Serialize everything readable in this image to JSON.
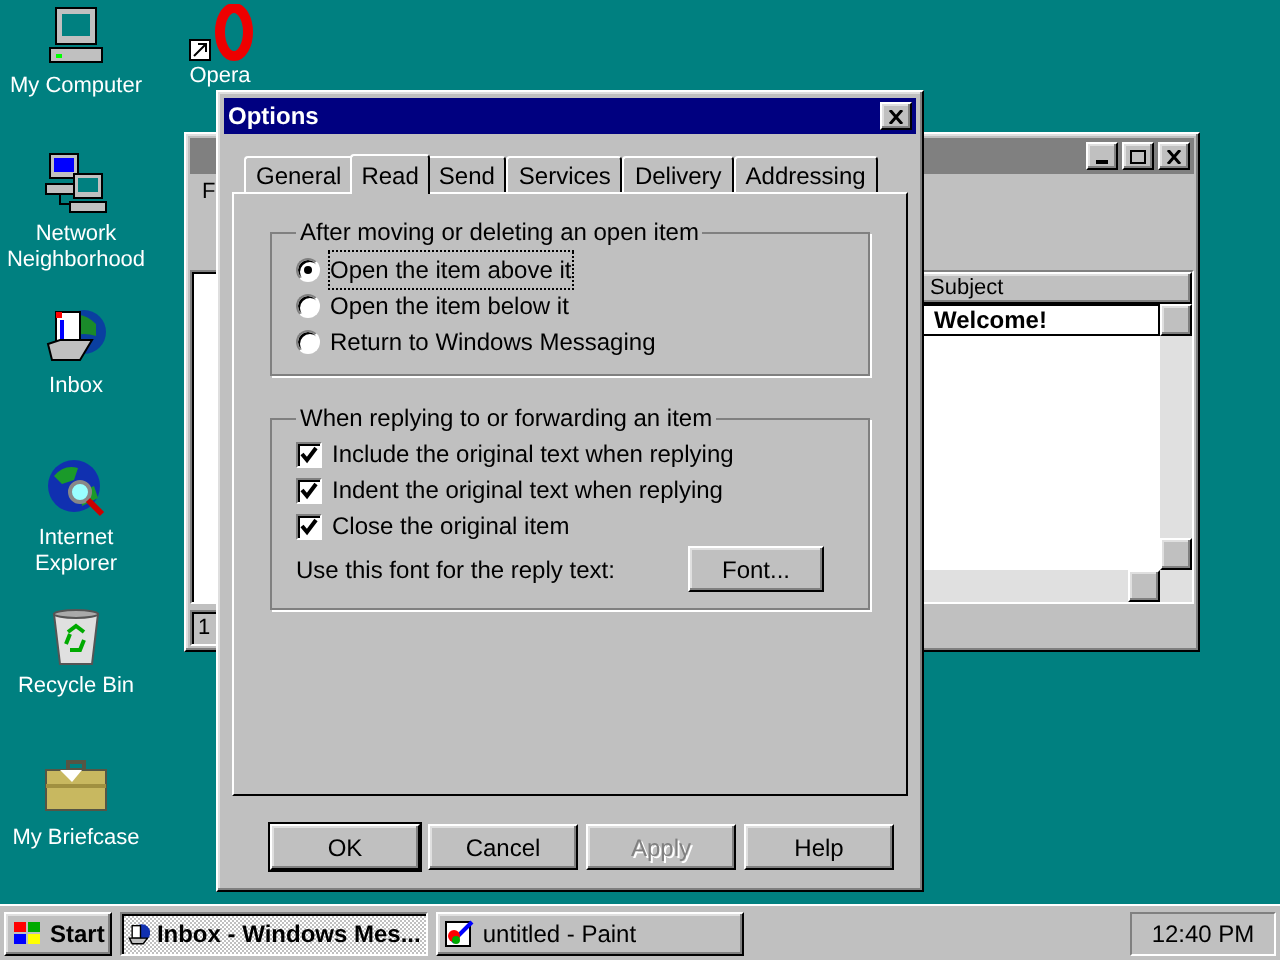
{
  "desktop_icons": [
    {
      "label": "My Computer",
      "kind": "computer"
    },
    {
      "label": "Network Neighborhood",
      "kind": "network"
    },
    {
      "label": "Inbox",
      "kind": "inbox"
    },
    {
      "label": "Internet Explorer",
      "kind": "browser"
    },
    {
      "label": "Recycle Bin",
      "kind": "recycle"
    },
    {
      "label": "My Briefcase",
      "kind": "briefcase"
    }
  ],
  "shortcut_icon": {
    "label": "Opera"
  },
  "background_window": {
    "menu_letter": "F",
    "column": "Subject",
    "row": "Welcome!",
    "status": "1"
  },
  "dialog": {
    "title": "Options",
    "tabs": [
      {
        "label": "General",
        "selected": false
      },
      {
        "label": "Read",
        "selected": true
      },
      {
        "label": "Send",
        "selected": false
      },
      {
        "label": "Services",
        "selected": false
      },
      {
        "label": "Delivery",
        "selected": false
      },
      {
        "label": "Addressing",
        "selected": false
      }
    ],
    "move_group": {
      "title": "After moving or deleting an open item",
      "options": [
        {
          "label": "Open the item above it",
          "selected": true
        },
        {
          "label": "Open the item below it",
          "selected": false
        },
        {
          "label": "Return to Windows Messaging",
          "selected": false
        }
      ]
    },
    "reply_group": {
      "title": "When replying to or forwarding an item",
      "checkboxes": [
        {
          "label": "Include the original text when replying",
          "checked": true
        },
        {
          "label": "Indent the original text when replying",
          "checked": true
        },
        {
          "label": "Close the original item",
          "checked": true
        }
      ],
      "font_label": "Use this font for the reply text:",
      "font_button": "Font..."
    },
    "buttons": [
      {
        "label": "OK",
        "default": true,
        "disabled": false
      },
      {
        "label": "Cancel",
        "default": false,
        "disabled": false
      },
      {
        "label": "Apply",
        "default": false,
        "disabled": true
      },
      {
        "label": "Help",
        "default": false,
        "disabled": false
      }
    ]
  },
  "taskbar": {
    "start": "Start",
    "tasks": [
      {
        "label": "Inbox - Windows Mes...",
        "selected": true,
        "kind": "inbox"
      },
      {
        "label": "untitled - Paint",
        "selected": false,
        "kind": "paint"
      }
    ],
    "clock": "12:40 PM"
  }
}
